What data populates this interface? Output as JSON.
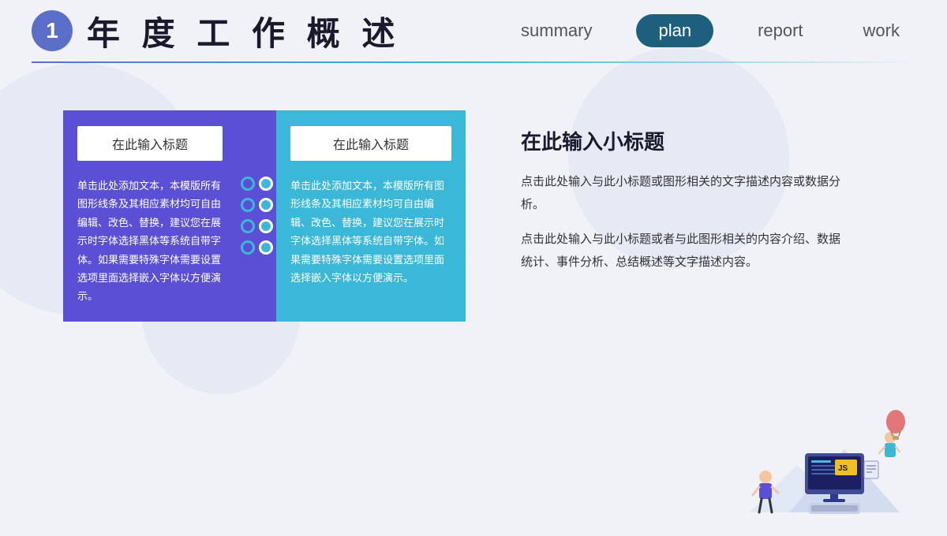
{
  "header": {
    "number": "1",
    "title": "年 度 工 作 概 述",
    "nav": [
      {
        "id": "summary",
        "label": "summary",
        "active": false
      },
      {
        "id": "plan",
        "label": "plan",
        "active": true
      },
      {
        "id": "report",
        "label": "report",
        "active": false
      },
      {
        "id": "work",
        "label": "work",
        "active": false
      }
    ]
  },
  "panel_left": {
    "title": "在此输入标题",
    "body": "单击此处添加文本，本模版所有图形线条及其相应素材均可自由编辑、改色、替换，建议您在展示时字体选择黑体等系统自带字体。如果需要特殊字体需要设置选项里面选择嵌入字体以方便演示。"
  },
  "panel_right": {
    "title": "在此输入标题",
    "body": "单击此处添加文本，本模版所有图形线条及其相应素材均可自由编辑、改色、替换，建议您在展示时字体选择黑体等系统自带字体。如果需要特殊字体需要设置选项里面选择嵌入字体以方便演示。"
  },
  "right_section": {
    "subtitle": "在此输入小标题",
    "desc1": "点击此处输入与此小标题或图形相关的文字描述内容或数据分析。",
    "desc2": "点击此处输入与此小标题或者与此图形相关的内容介绍、数据统计、事件分析、总结概述等文字描述内容。"
  },
  "colors": {
    "purple": "#5b4fd6",
    "cyan": "#3bb8d8",
    "nav_active": "#1d5f7c",
    "badge": "#5b6ec8"
  }
}
